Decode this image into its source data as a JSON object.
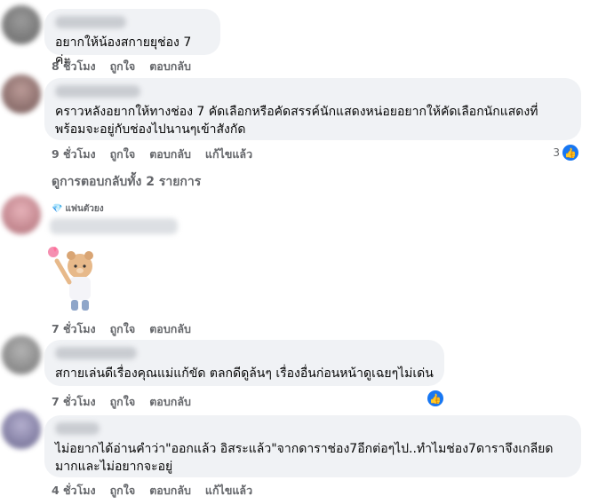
{
  "comments": [
    {
      "text": "อยากให้น้องสกายยุช่อง 7 ค่ะ",
      "time": "8 ชั่วโมง",
      "like": "ถูกใจ",
      "reply": "ตอบกลับ"
    },
    {
      "text_line1": "คราวหลังอยากให้ทางช่อง 7 คัดเลือกหรือคัดสรรค์นักแสดงหน่อยอยากให้คัดเลือกนักแสดงที่",
      "text_line2": "พร้อมจะอยู่กับช่องไปนานๆเข้าสังกัด",
      "time": "9 ชั่วโมง",
      "like": "ถูกใจ",
      "reply": "ตอบกลับ",
      "edited": "แก้ไขแล้ว",
      "like_count": "3",
      "view_replies": "ดูการตอบกลับทั้ง 2 รายการ"
    },
    {
      "badge": "แฟนตัวยง",
      "time": "7 ชั่วโมง",
      "like": "ถูกใจ",
      "reply": "ตอบกลับ"
    },
    {
      "text": "สกายเล่นดีเรื่องคุณแม่แก้ขัด ตลกดีดูล้นๆ เรื่องอื่นก่อนหน้าดูเฉยๆไม่เด่น",
      "time": "7 ชั่วโมง",
      "like": "ถูกใจ",
      "reply": "ตอบกลับ"
    },
    {
      "text_line1": "ไม่อยากได้อ่านคำว่า\"ออกแล้ว อิสระแล้ว\"จากดาราช่อง7อีกต่อๆไป..ทำไมช่อง7ดาราจึงเกลียด",
      "text_line2": "มากและไม่อยากจะอยู่",
      "time": "4 ชั่วโมง",
      "like": "ถูกใจ",
      "reply": "ตอบกลับ",
      "edited": "แก้ไขแล้ว"
    }
  ],
  "colors": {
    "bubble": "#f0f2f5",
    "meta": "#65676b",
    "like_blue": "#1877f2"
  }
}
